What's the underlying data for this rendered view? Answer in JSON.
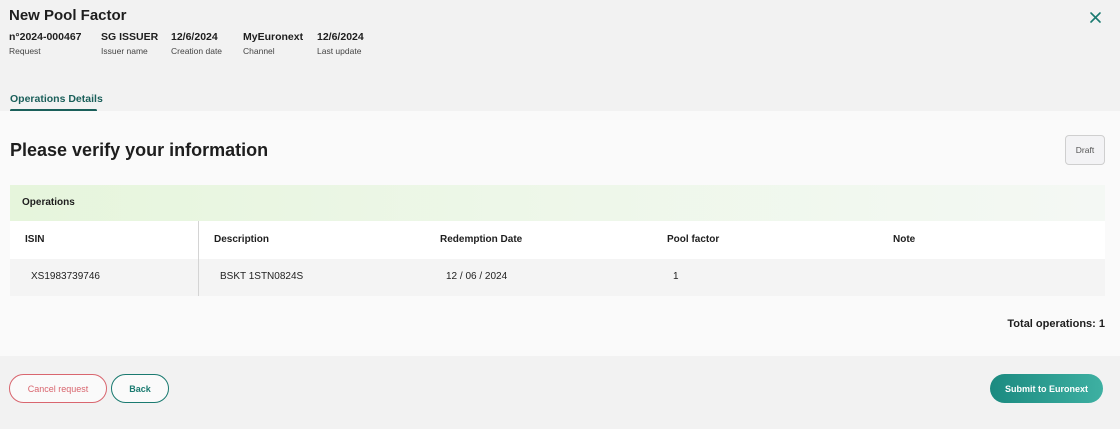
{
  "header": {
    "title": "New Pool Factor",
    "close_icon": "close-icon"
  },
  "meta": [
    {
      "value": "n°2024-000467",
      "label": "Request"
    },
    {
      "value": "SG ISSUER",
      "label": "Issuer name"
    },
    {
      "value": "12/6/2024",
      "label": "Creation date"
    },
    {
      "value": "MyEuronext",
      "label": "Channel"
    },
    {
      "value": "12/6/2024",
      "label": "Last update"
    }
  ],
  "tabs": [
    {
      "label": "Operations Details",
      "active": true
    }
  ],
  "main": {
    "heading": "Please verify your information",
    "draft_label": "Draft",
    "operations_title": "Operations",
    "total_label": "Total operations: 1"
  },
  "table": {
    "columns": [
      "ISIN",
      "Description",
      "Redemption Date",
      "Pool factor",
      "Note"
    ],
    "rows": [
      [
        "XS1983739746",
        "BSKT 1STN0824S",
        "12 / 06 / 2024",
        "1",
        ""
      ]
    ]
  },
  "footer": {
    "cancel_label": "Cancel request",
    "back_label": "Back",
    "submit_label": "Submit to Euronext"
  },
  "colors": {
    "accent": "#1a5f5a",
    "submit_start": "#1b8a80",
    "submit_end": "#3eb0a2",
    "danger": "#d9666f",
    "ops_header_green": "#e6f5dc"
  }
}
